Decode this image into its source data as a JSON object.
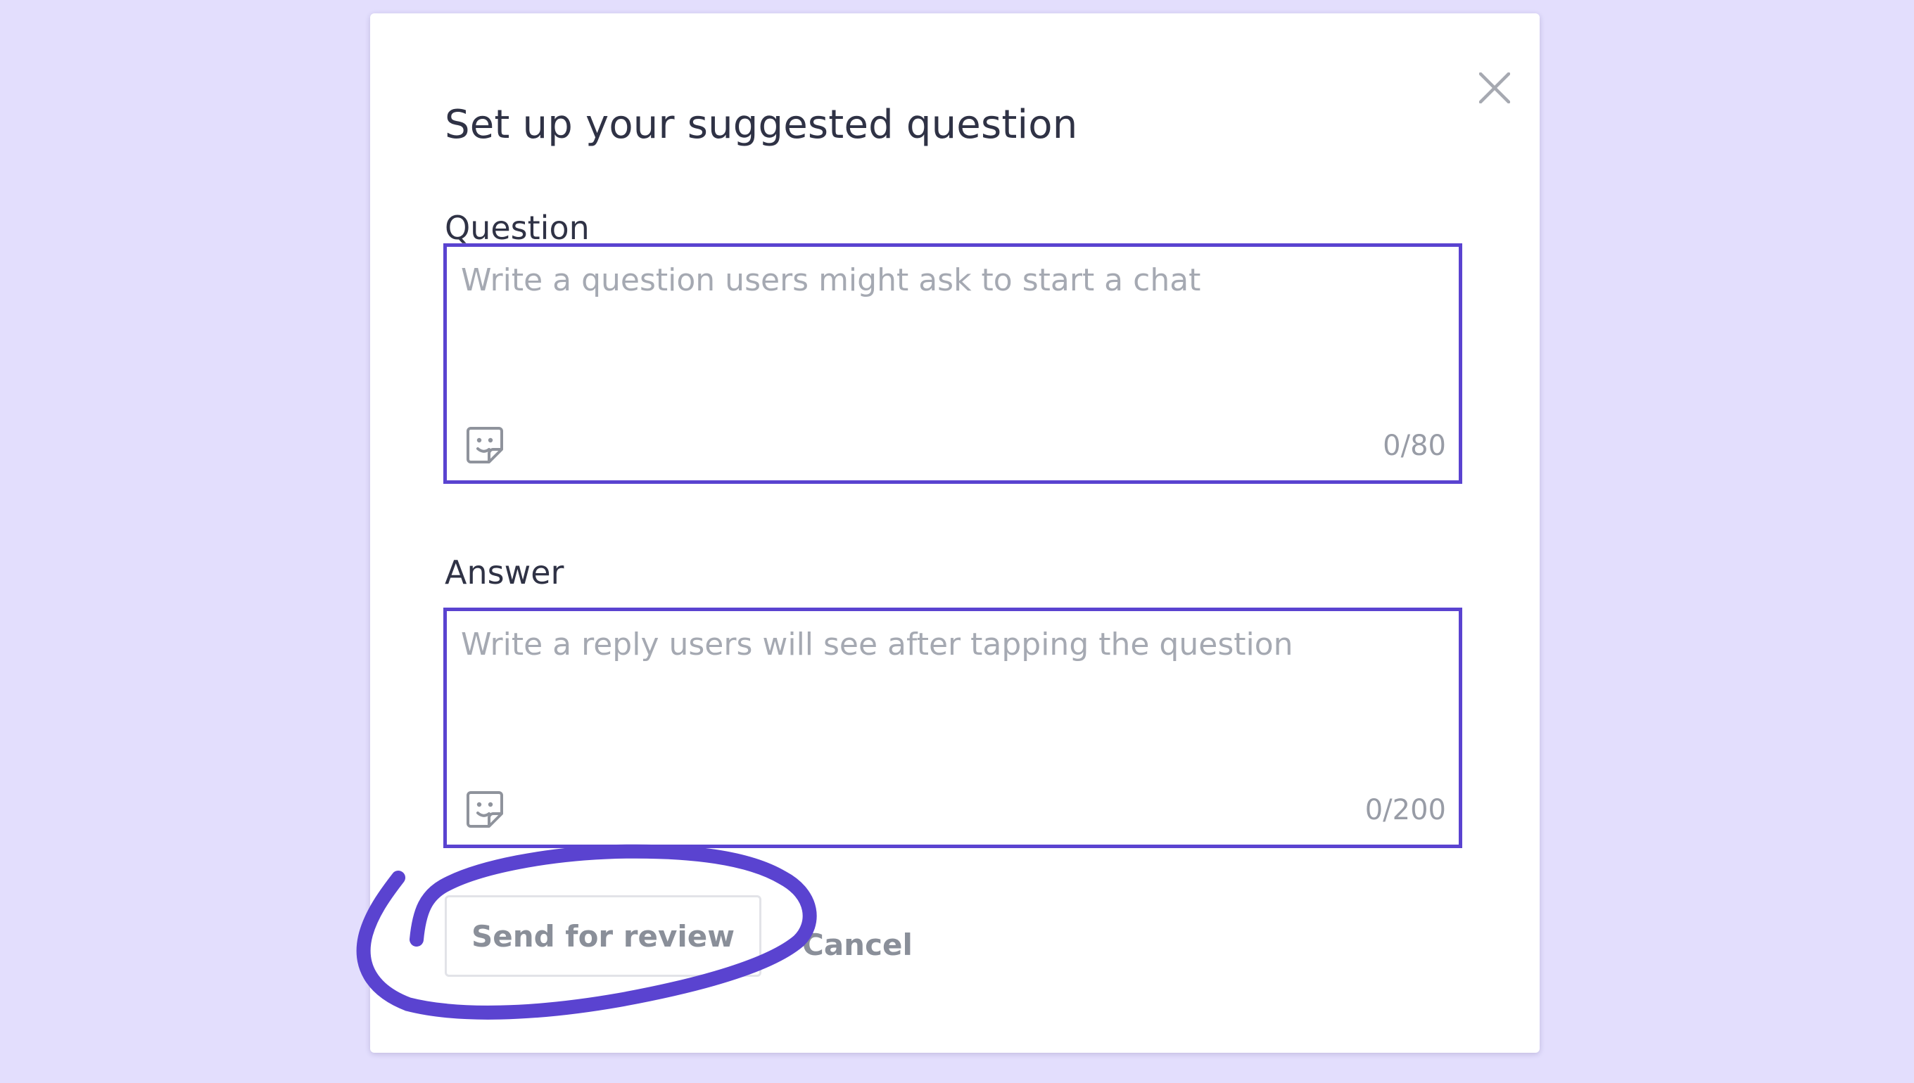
{
  "colors": {
    "page_background": "#e3defd",
    "accent": "#5a43d0",
    "annotation": "#5a43d0"
  },
  "dialog": {
    "title": "Set up your suggested question",
    "close_icon": "close-icon"
  },
  "question": {
    "label": "Question",
    "placeholder": "Write a question users might ask to start a chat",
    "value": "",
    "counter": "0/80",
    "sticker_icon": "sticker-icon"
  },
  "answer": {
    "label": "Answer",
    "placeholder": "Write a reply users will see after tapping the question",
    "value": "",
    "counter": "0/200",
    "sticker_icon": "sticker-icon"
  },
  "actions": {
    "send_label": "Send for review",
    "cancel_label": "Cancel"
  }
}
